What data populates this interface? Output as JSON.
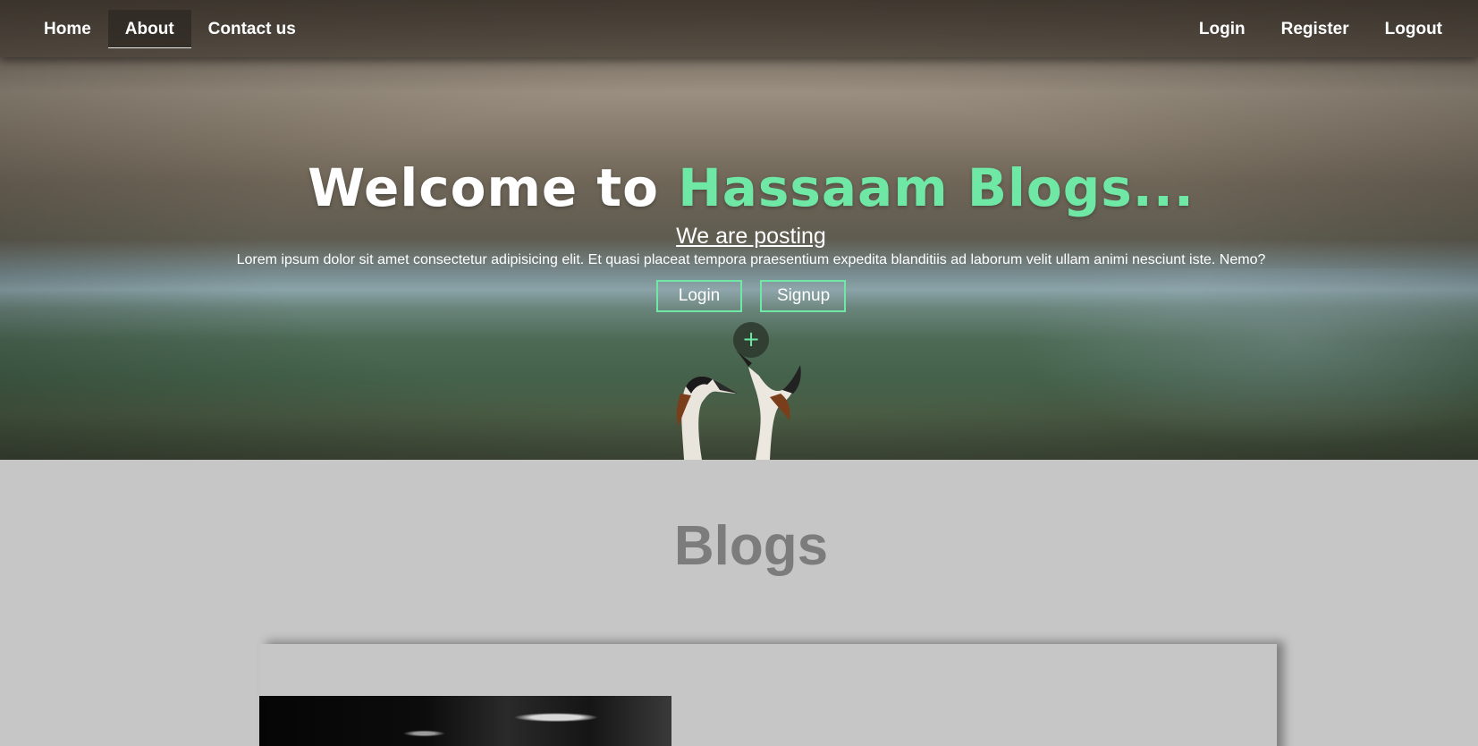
{
  "nav": {
    "left": [
      {
        "label": "Home",
        "active": false
      },
      {
        "label": "About",
        "active": true
      },
      {
        "label": "Contact us",
        "active": false
      }
    ],
    "right": [
      {
        "label": "Login"
      },
      {
        "label": "Register"
      },
      {
        "label": "Logout"
      }
    ]
  },
  "hero": {
    "title_prefix": "Welcome to ",
    "title_accent": "Hassaam Blogs...",
    "subtitle": "We are posting",
    "description": "Lorem ipsum dolor sit amet consectetur adipisicing elit. Et quasi placeat tempora praesentium expedita blanditiis ad laborum velit ullam animi nesciunt iste. Nemo?",
    "buttons": {
      "login": "Login",
      "signup": "Signup"
    },
    "plus_icon": "plus-icon",
    "accent_color": "#6fe8a6"
  },
  "blogs": {
    "heading": "Blogs"
  }
}
